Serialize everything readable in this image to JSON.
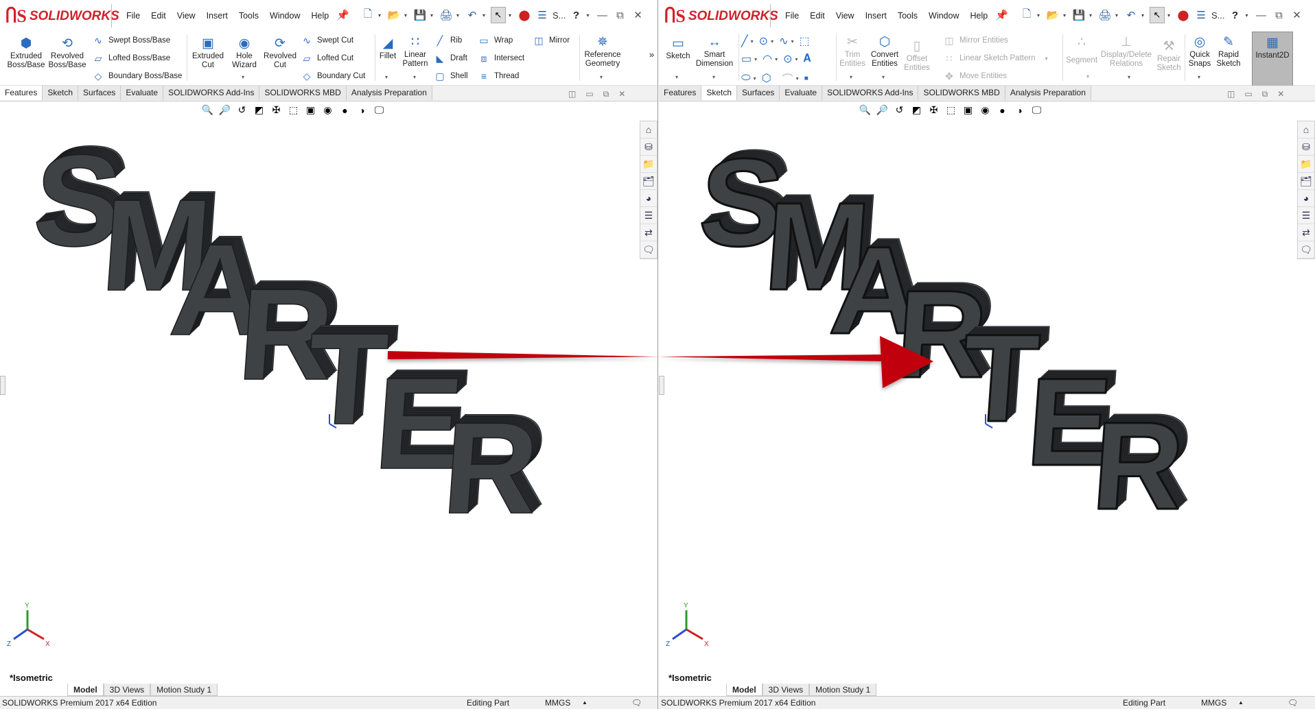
{
  "app": {
    "logo_text": "SOLIDWORKS",
    "menus": [
      "File",
      "Edit",
      "View",
      "Insert",
      "Tools",
      "Window",
      "Help"
    ],
    "qat_truncated": "S...",
    "help_label": "?"
  },
  "left": {
    "features": {
      "extruded_boss": "Extruded Boss/Base",
      "revolved_boss": "Revolved Boss/Base",
      "swept_boss": "Swept Boss/Base",
      "lofted_boss": "Lofted Boss/Base",
      "boundary_boss": "Boundary Boss/Base",
      "extruded_cut": "Extruded Cut",
      "hole_wizard": "Hole Wizard",
      "revolved_cut": "Revolved Cut",
      "swept_cut": "Swept Cut",
      "lofted_cut": "Lofted Cut",
      "boundary_cut": "Boundary Cut",
      "fillet": "Fillet",
      "linear_pattern": "Linear Pattern",
      "rib": "Rib",
      "draft": "Draft",
      "shell": "Shell",
      "wrap": "Wrap",
      "intersect": "Intersect",
      "thread": "Thread",
      "mirror": "Mirror",
      "reference_geometry": "Reference Geometry",
      "more": "»"
    },
    "active_tab": "Features"
  },
  "right": {
    "sketch": {
      "sketch": "Sketch",
      "smart_dimension": "Smart Dimension",
      "trim_entities": "Trim Entities",
      "convert_entities": "Convert Entities",
      "offset_entities": "Offset Entities",
      "mirror_entities": "Mirror Entities",
      "linear_sketch_pattern": "Linear Sketch Pattern",
      "move_entities": "Move Entities",
      "segment": "Segment",
      "display_delete_relations": "Display/Delete Relations",
      "repair_sketch": "Repair Sketch",
      "quick_snaps": "Quick Snaps",
      "rapid_sketch": "Rapid Sketch",
      "instant2d": "Instant2D"
    },
    "active_tab": "Sketch"
  },
  "tabs": [
    "Features",
    "Sketch",
    "Surfaces",
    "Evaluate",
    "SOLIDWORKS Add-Ins",
    "SOLIDWORKS MBD",
    "Analysis Preparation"
  ],
  "viewport": {
    "model_text": "SMARTER",
    "view_name": "*Isometric",
    "triad": {
      "x": "X",
      "y": "Y",
      "z": "Z"
    }
  },
  "bottom_tabs": [
    "Model",
    "3D Views",
    "Motion Study 1"
  ],
  "status": {
    "edition": "SOLIDWORKS Premium 2017 x64 Edition",
    "mode": "Editing Part",
    "units": "MMGS",
    "units_arrow": "▲"
  },
  "colors": {
    "brand_red": "#d0222a",
    "model_gray": "#3f4245",
    "arrow_red": "#c0000a",
    "instant2d_active": "#b9b9b9"
  },
  "icons": {
    "pin": "pin-icon",
    "new": "new-doc-icon",
    "open": "open-icon",
    "save": "save-icon",
    "print": "print-icon",
    "undo": "undo-icon",
    "select": "select-icon",
    "rebuild": "rebuild-icon",
    "options": "options-icon",
    "help": "help-icon"
  }
}
